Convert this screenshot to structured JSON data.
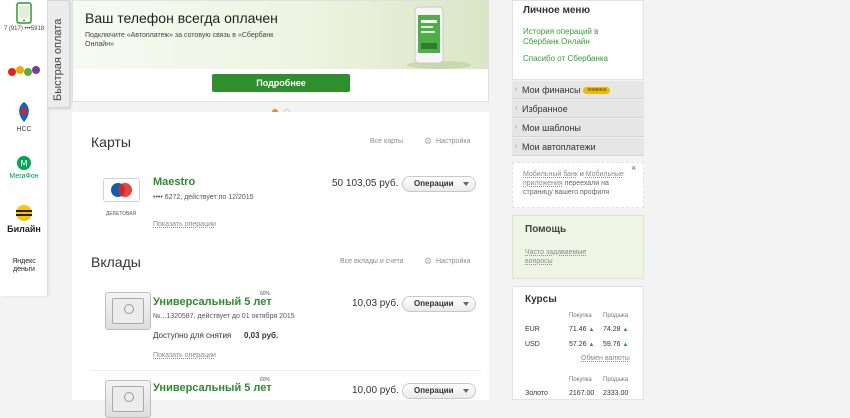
{
  "rail": {
    "phone": "7 (917) •••5918",
    "operators": [
      {
        "label": "НСС"
      },
      {
        "label": "МегаФон"
      },
      {
        "label": "Билайн"
      },
      {
        "label": "Яндекс деньги"
      }
    ],
    "quick_pay": "Быстрая оплата"
  },
  "banner": {
    "title": "Ваш телефон всегда оплачен",
    "subtitle": "Подключите «Автоплатеж» за сотовую связь в «Сбербанк Онлайн»",
    "button": "Подробнее"
  },
  "cards": {
    "title": "Карты",
    "all_link": "Все карты",
    "settings_link": "Настройка",
    "items": [
      {
        "name": "Maestro",
        "card_type": "ДЕБЕТОВАЯ",
        "details": "•••• 6272, действует по 12/2015",
        "amount": "50 103,05 руб.",
        "ops_button": "Операции",
        "show_ops": "Показать операции"
      }
    ]
  },
  "deposits": {
    "title": "Вклады",
    "all_link": "Все вклады и счета",
    "settings_link": "Настройка",
    "items": [
      {
        "name": "Универсальный 5 лет",
        "rate": "60%",
        "details": "№...1320587, действует до 01 октября 2015",
        "amount": "10,03 руб.",
        "available_label": "Доступно для снятия",
        "available_amount": "0,03 руб.",
        "ops_button": "Операции",
        "show_ops": "Показать операции"
      },
      {
        "name": "Универсальный 5 лет",
        "rate": "60%",
        "amount": "10,00 руб.",
        "ops_button": "Операции"
      }
    ]
  },
  "personal_menu": {
    "title": "Личное меню",
    "links": [
      "История операций в Сбербанк Онлайн",
      "Спасибо от Сбербанка"
    ],
    "rows": [
      {
        "label": "Мои финансы",
        "badge": "новинка"
      },
      {
        "label": "Избранное"
      },
      {
        "label": "Мои шаблоны"
      },
      {
        "label": "Мои автоплатежи"
      }
    ]
  },
  "notice": {
    "part1": "Мобильный банк",
    "part2": " и ",
    "part3": "Мобильные приложения",
    "part4": " переехали на страницу вашего профиля"
  },
  "help": {
    "title": "Помощь",
    "link": "Часто задаваемые вопросы"
  },
  "rates": {
    "title": "Курсы",
    "buy_label": "Покупка",
    "sell_label": "Продажа",
    "currencies": [
      {
        "code": "EUR",
        "buy": "71.46",
        "sell": "74.28"
      },
      {
        "code": "USD",
        "buy": "57.26",
        "sell": "59.76"
      }
    ],
    "exchange_link": "Обмен валюты",
    "metals_buy_label": "Покупка",
    "metals_sell_label": "Продажа",
    "metals": [
      {
        "name": "Золото",
        "buy": "2167.00",
        "sell": "2333.00"
      }
    ]
  },
  "colors": {
    "accent": "#2e8b2e",
    "button_green": "#2f8f2f",
    "dot_active": "#f08a24"
  }
}
